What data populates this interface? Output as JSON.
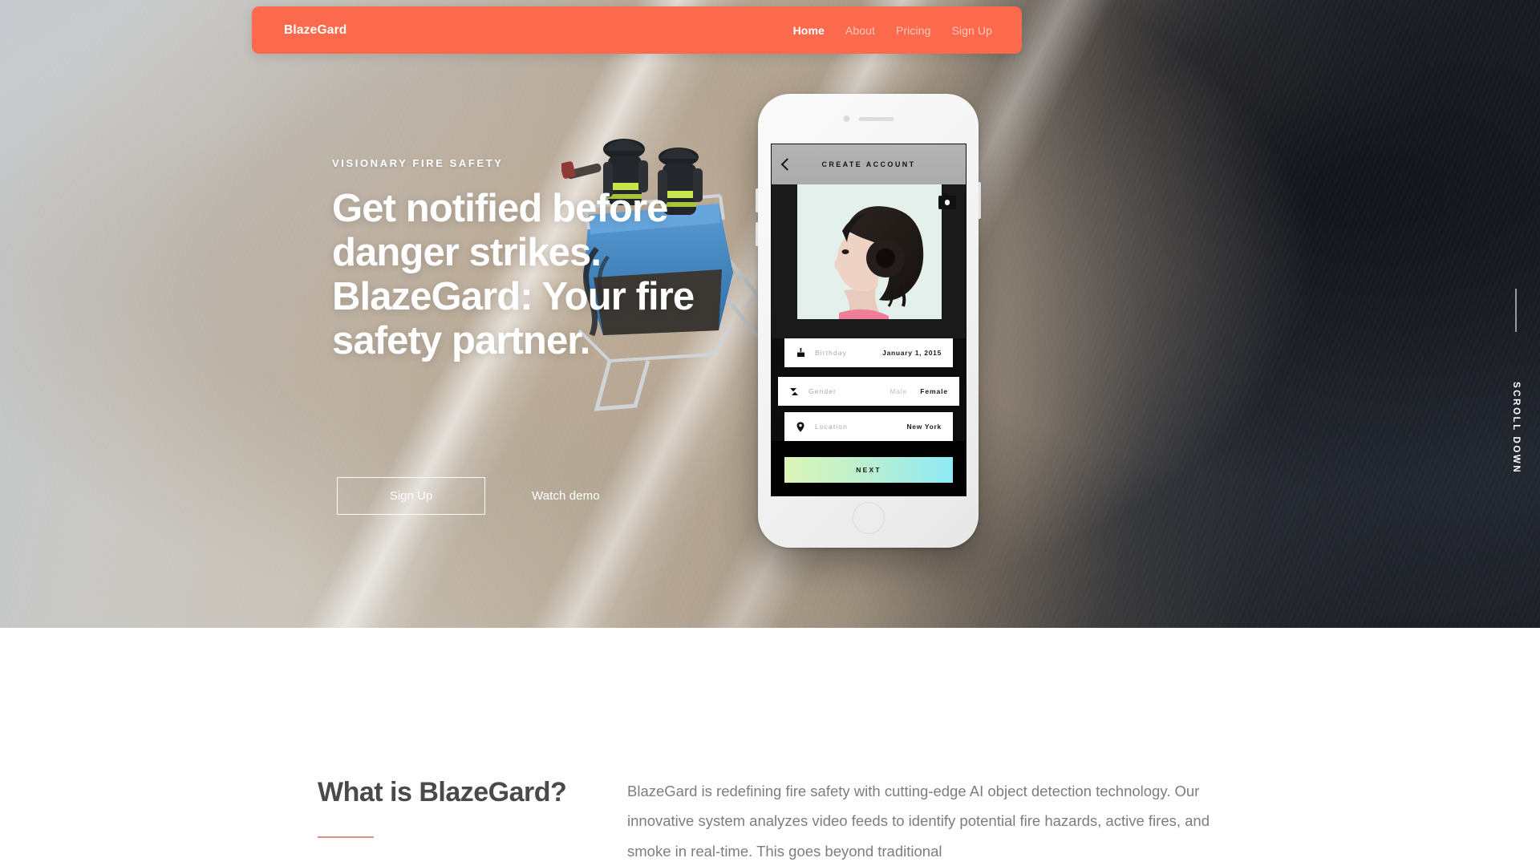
{
  "brand": {
    "name": "BlazeGard"
  },
  "nav": {
    "items": [
      {
        "label": "Home",
        "active": true
      },
      {
        "label": "About",
        "active": false
      },
      {
        "label": "Pricing",
        "active": false
      },
      {
        "label": "Sign Up",
        "active": false
      }
    ]
  },
  "hero": {
    "eyebrow": "VISIONARY FIRE SAFETY",
    "headline": "Get notified before danger strikes. BlazeGard: Your fire safety partner.",
    "primary_cta": "Sign Up",
    "secondary_cta": "Watch demo",
    "scroll_hint": "SCROLL DOWN",
    "background_image": "firefighters-aerial-ladder-smoke-photo"
  },
  "phone": {
    "screen_title": "CREATE ACCOUNT",
    "back_icon": "chevron-left-icon",
    "camera_icon": "camera-icon",
    "avatar_image": "woman-profile-portrait-photo",
    "fields": [
      {
        "icon": "cake-icon",
        "label": "Birthday",
        "value": "January 1, 2015"
      },
      {
        "icon": "updown-arrows-icon",
        "label": "Gender",
        "options": [
          "Male",
          "Female"
        ],
        "selected": "Female"
      },
      {
        "icon": "location-pin-icon",
        "label": "Location",
        "value": "New York"
      }
    ],
    "next_label": "NEXT"
  },
  "about": {
    "title": "What is BlazeGard?",
    "body": "BlazeGard is redefining fire safety with cutting-edge AI object detection technology. Our innovative system analyzes video feeds to identify potential fire hazards, active fires, and smoke in real-time. This goes beyond traditional"
  },
  "colors": {
    "brand_coral": "#fb6a4d",
    "accent_rule": "#e08f80",
    "next_gradient_start": "#dcf5b6",
    "next_gradient_end": "#8fe9f5",
    "heading_gray": "#4a4a4a",
    "body_gray": "#7d7d7d"
  }
}
